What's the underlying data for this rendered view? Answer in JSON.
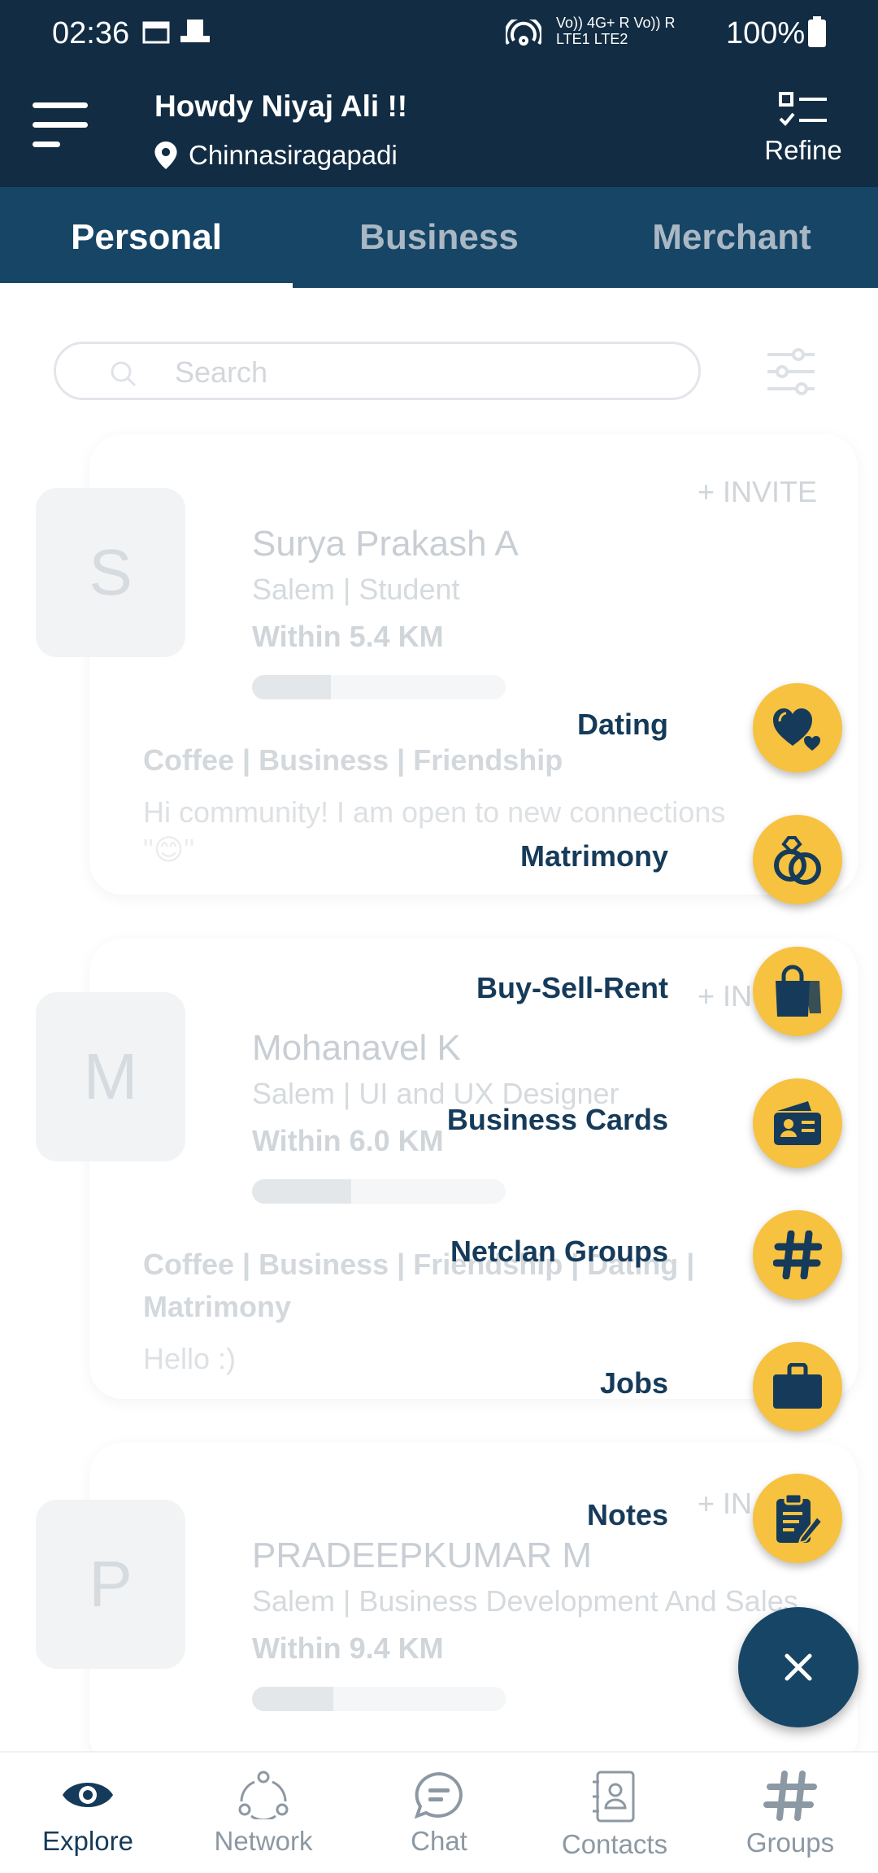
{
  "status_bar": {
    "time": "02:36",
    "network_line1": "Vo)) 4G+ R Vo)) R",
    "network_line2": "LTE1 LTE2",
    "battery": "100%"
  },
  "header": {
    "greeting": "Howdy Niyaj Ali !!",
    "location": "Chinnasiragapadi",
    "refine_label": "Refine"
  },
  "tabs": [
    {
      "label": "Personal",
      "active": true
    },
    {
      "label": "Business",
      "active": false
    },
    {
      "label": "Merchant",
      "active": false
    }
  ],
  "search": {
    "placeholder": "Search"
  },
  "cards": [
    {
      "initial": "S",
      "name": "Surya Prakash A",
      "role": "Salem | Student",
      "distance": "Within 5.4 KM",
      "progress": 0.31,
      "invite": "+ INVITE",
      "tags": "Coffee | Business | Friendship",
      "message": "Hi community! I am open to new connections",
      "message2": "\"😊\""
    },
    {
      "initial": "M",
      "name": "Mohanavel K",
      "role": "Salem | UI and UX Designer",
      "distance": "Within 6.0 KM",
      "progress": 0.39,
      "invite": "+ IN",
      "tags": "Coffee | Business | Friendship | Dating |",
      "tags2": "Matrimony",
      "message": "Hello :)"
    },
    {
      "initial": "P",
      "name": "PRADEEPKUMAR M",
      "role": "Salem | Business Development And Sales",
      "distance": "Within 9.4 KM",
      "progress": 0.32,
      "invite": "+ IN"
    }
  ],
  "speed_dial": [
    {
      "label": "Dating",
      "icon": "hearts-icon"
    },
    {
      "label": "Matrimony",
      "icon": "rings-icon"
    },
    {
      "label": "Buy-Sell-Rent",
      "icon": "shopping-bag-icon"
    },
    {
      "label": "Business Cards",
      "icon": "id-card-icon"
    },
    {
      "label": "Netclan Groups",
      "icon": "hashtag-icon"
    },
    {
      "label": "Jobs",
      "icon": "briefcase-icon"
    },
    {
      "label": "Notes",
      "icon": "clipboard-icon"
    }
  ],
  "bottom_nav": [
    {
      "label": "Explore",
      "icon": "eye-icon",
      "active": true
    },
    {
      "label": "Network",
      "icon": "network-icon",
      "active": false
    },
    {
      "label": "Chat",
      "icon": "chat-icon",
      "active": false
    },
    {
      "label": "Contacts",
      "icon": "contacts-icon",
      "active": false
    },
    {
      "label": "Groups",
      "icon": "hashtag-icon",
      "active": false
    }
  ],
  "colors": {
    "primary": "#122c43",
    "tab_bar": "#174566",
    "accent": "#f6c240",
    "text_dark": "#163b5a"
  }
}
